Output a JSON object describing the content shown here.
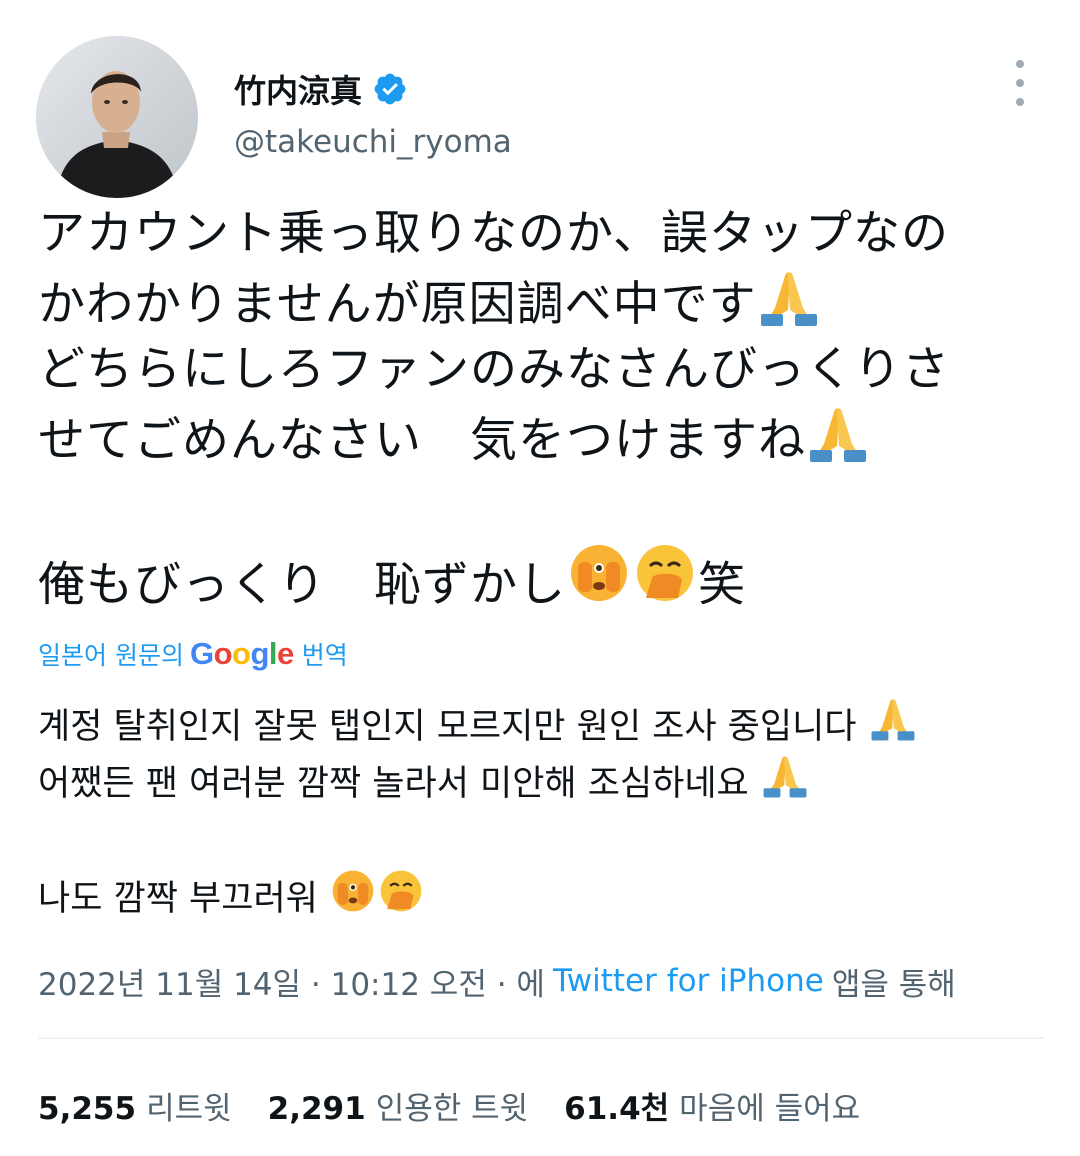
{
  "author": {
    "display_name": "竹内涼真",
    "handle": "@takeuchi_ryoma",
    "verified": true,
    "accent_color": "#1d9bf0"
  },
  "tweet": {
    "lines": [
      "アカウント乗っ取りなのか、誤タップなの",
      "かわかりませんが原因調べ中です",
      "どちらにしろファンのみなさんびっくりさ",
      "せてごめんなさい　気をつけますね",
      "",
      "俺もびっくり　恥ずかし",
      "笑"
    ]
  },
  "translation": {
    "prefix": "일본어 원문의",
    "logo_text": "Google",
    "suffix": "번역",
    "lines": [
      "계정 탈취인지 잘못 탭인지 모르지만 원인 조사 중입니다",
      "어쨌든 팬 여러분 깜짝 놀라서 미안해 조심하네요",
      "",
      "나도 깜짝 부끄러워"
    ]
  },
  "meta": {
    "date": "2022년 11월 14일 · 10:12 오전 · 에",
    "source": "Twitter for iPhone",
    "suffix": "앱을 통해"
  },
  "stats": [
    {
      "count": "5,255",
      "label": "리트윗"
    },
    {
      "count": "2,291",
      "label": "인용한 트윗"
    },
    {
      "count": "61.4천",
      "label": "마음에 들어요"
    }
  ],
  "icons": {
    "verified": "verified-badge-icon",
    "more": "more-options-icon",
    "pray": "folded-hands-emoji",
    "peek": "face-with-peeking-eye-emoji",
    "giggle": "face-with-hand-over-mouth-emoji"
  }
}
